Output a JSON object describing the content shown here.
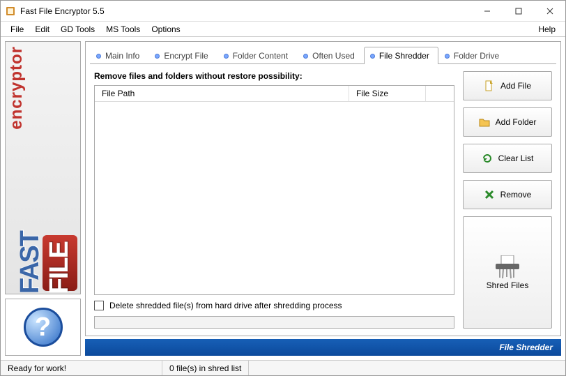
{
  "window": {
    "title": "Fast File Encryptor 5.5"
  },
  "menu": {
    "items": [
      "File",
      "Edit",
      "GD Tools",
      "MS Tools",
      "Options"
    ],
    "help": "Help"
  },
  "banner": {
    "fast": "FAST",
    "file": "FILE",
    "encryptor": "encryptor"
  },
  "tabs": [
    {
      "label": "Main Info"
    },
    {
      "label": "Encrypt File"
    },
    {
      "label": "Folder Content"
    },
    {
      "label": "Often Used"
    },
    {
      "label": "File Shredder"
    },
    {
      "label": "Folder Drive"
    }
  ],
  "active_tab_index": 4,
  "shredder": {
    "instruction": "Remove files and folders without restore possibility:",
    "col_path": "File Path",
    "col_size": "File Size",
    "delete_checkbox": "Delete shredded file(s) from hard drive after shredding process",
    "buttons": {
      "add_file": "Add File",
      "add_folder": "Add Folder",
      "clear_list": "Clear List",
      "remove": "Remove",
      "shred": "Shred Files"
    }
  },
  "footer_title": "File Shredder",
  "status": {
    "left": "Ready for work!",
    "mid": "0 file(s) in shred list"
  }
}
